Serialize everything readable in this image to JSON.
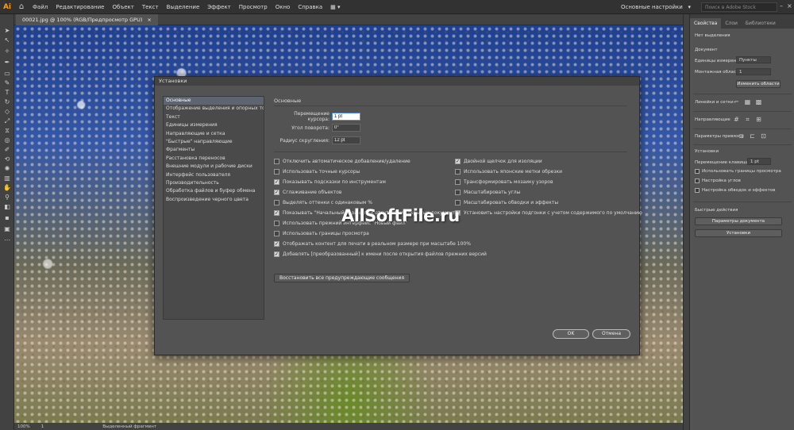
{
  "menubar": {
    "logo": "Ai",
    "items": [
      "Файл",
      "Редактирование",
      "Объект",
      "Текст",
      "Выделение",
      "Эффект",
      "Просмотр",
      "Окно",
      "Справка"
    ],
    "workspace": "Основные настройки",
    "search_placeholder": "Поиск в Adobe Stock"
  },
  "document": {
    "tab_label": "00021.jpg @ 100% (RGB/Предпросмотр GPU)"
  },
  "status": {
    "zoom": "100%",
    "page": "1",
    "tool_name": "Выделенный фрагмент"
  },
  "dialog": {
    "title": "Установки",
    "nav_items": [
      "Основные",
      "Отображение выделения и опорных точек",
      "Текст",
      "Единицы измерения",
      "Направляющие и сетка",
      "\"Быстрые\" направляющие",
      "Фрагменты",
      "Расстановка переносов",
      "Внешние модули и рабочие диски",
      "Интерфейс пользователя",
      "Производительность",
      "Обработка файлов и буфер обмена",
      "Воспроизведение черного цвета"
    ],
    "selected_nav": 0,
    "section_title": "Основные",
    "fields": {
      "cursor_move_label": "Перемещение курсора:",
      "cursor_move_value": "1 pt",
      "rotation_label": "Угол поворота:",
      "rotation_value": "0°",
      "radius_label": "Радиус скругления:",
      "radius_value": "12 pt"
    },
    "checkboxes_left": [
      {
        "label": "Отключить автоматическое добавление/удаление",
        "checked": false
      },
      {
        "label": "Использовать точные курсоры",
        "checked": false
      },
      {
        "label": "Показывать подсказки по инструментам",
        "checked": true
      },
      {
        "label": "Сглаживание объектов",
        "checked": true
      },
      {
        "label": "Выделять оттенки с одинаковым %",
        "checked": false
      },
      {
        "label": "Показывать \"Начальный экран\" при отсутствии открытых документов",
        "checked": true
      },
      {
        "label": "Использовать прежний интерфейс \"Новый файл\"",
        "checked": false
      },
      {
        "label": "Использовать границы просмотра",
        "checked": false
      },
      {
        "label": "Отображать контент для печати в реальном размере при масштабе 100%",
        "checked": true
      },
      {
        "label": "Добавлять [преобразованный] к имени после открытия файлов прежних версий",
        "checked": true
      }
    ],
    "checkboxes_right": [
      {
        "label": "Двойной щелчок для изоляции",
        "checked": true
      },
      {
        "label": "Использовать японские метки обрезки",
        "checked": false
      },
      {
        "label": "Трансформировать мозаику узоров",
        "checked": false
      },
      {
        "label": "Масштабировать углы",
        "checked": false
      },
      {
        "label": "Масштабировать обводки и эффекты",
        "checked": false
      },
      {
        "label": "Установить настройки подгонки с учетом содержимого по умолчанию",
        "checked": true
      }
    ],
    "reset_button": "Восстановить все предупреждающие сообщения",
    "ok_button": "OK",
    "cancel_button": "Отмена"
  },
  "right_panel": {
    "tabs": [
      "Свойства",
      "Слои",
      "Библиотеки"
    ],
    "active_tab": 0,
    "no_selection": "Нет выделения",
    "document_label": "Документ",
    "units_label": "Единицы измерения:",
    "units_value": "Пункты",
    "artboard_label": "Монтажная область:",
    "artboard_value": "1",
    "edit_artboards_button": "Изменить области",
    "rulers_label": "Линейки и сетки",
    "guides_label": "Направляющие",
    "snap_label": "Параметры привязки",
    "settings_label": "Установки",
    "keyboard_label": "Перемещение клавишами:",
    "keyboard_value": "1 pt",
    "pref_checks": [
      "Использовать границы просмотра",
      "Настройка углов",
      "Настройка обводок и эффектов"
    ],
    "quick_actions_label": "Быстрые действия",
    "doc_setup_button": "Параметры документа",
    "prefs_button": "Установки"
  },
  "watermark": {
    "text_main": "AllSoftFile",
    "text_suffix": ".ru"
  },
  "colors": {
    "accent": "#ff9a00",
    "selection": "#5e6470",
    "focus": "#4f8edc"
  }
}
